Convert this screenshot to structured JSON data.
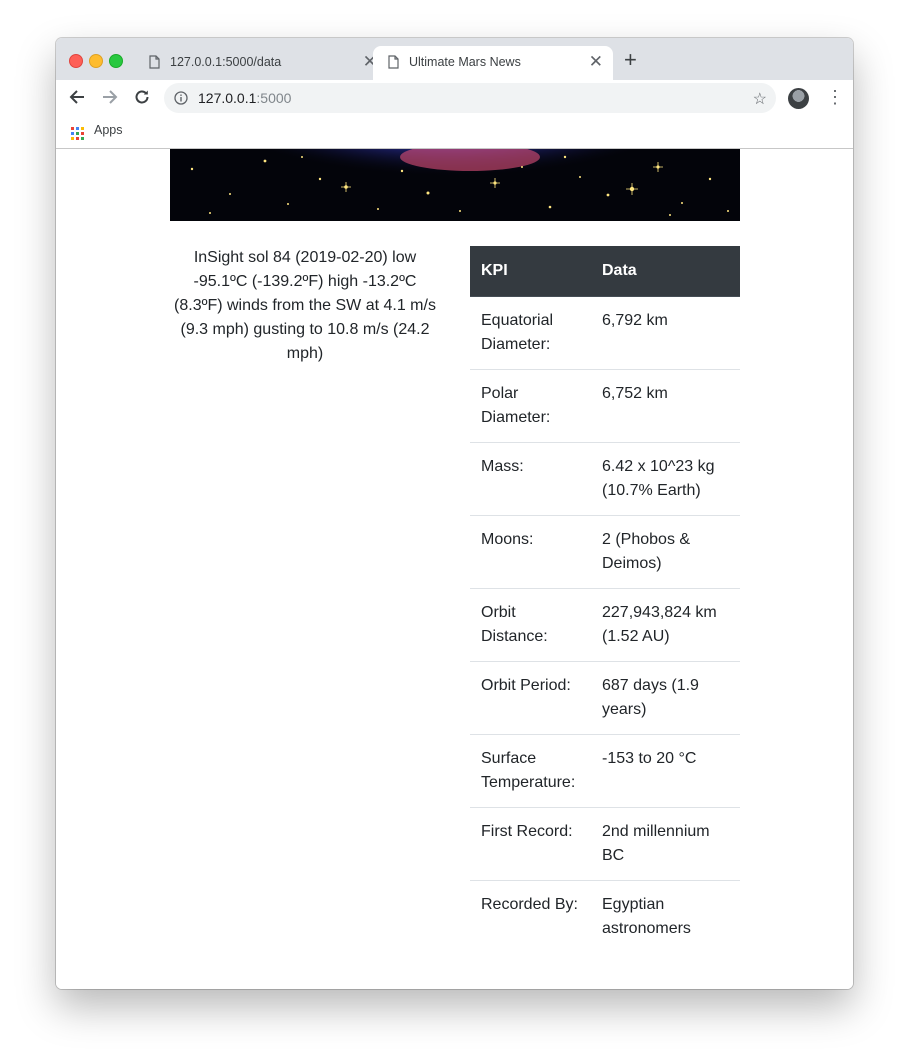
{
  "browser": {
    "tabs": [
      {
        "title": "127.0.0.1:5000/data",
        "active": false
      },
      {
        "title": "Ultimate Mars News",
        "active": true
      }
    ],
    "url_host": "127.0.0.1",
    "url_port": ":5000",
    "bookmarks": {
      "apps_label": "Apps"
    },
    "colors": {
      "tabstrip": "#dee1e6",
      "omnibox": "#f1f3f4"
    }
  },
  "page": {
    "weather_text": "InSight sol 84 (2019-02-20) low -95.1ºC (-139.2ºF) high -13.2ºC (8.3ºF) winds from the SW at 4.1 m/s (9.3 mph) gusting to 10.8 m/s (24.2 mph)",
    "facts_table": {
      "headers": {
        "kpi": "KPI",
        "data": "Data"
      },
      "rows": [
        {
          "kpi": "Equatorial Diameter:",
          "data": "6,792 km"
        },
        {
          "kpi": "Polar Diameter:",
          "data": "6,752 km"
        },
        {
          "kpi": "Mass:",
          "data": "6.42 x 10^23 kg (10.7% Earth)"
        },
        {
          "kpi": "Moons:",
          "data": "2 (Phobos & Deimos)"
        },
        {
          "kpi": "Orbit Distance:",
          "data": "227,943,824 km (1.52 AU)"
        },
        {
          "kpi": "Orbit Period:",
          "data": "687 days (1.9 years)"
        },
        {
          "kpi": "Surface Temperature:",
          "data": "-153 to 20 °C"
        },
        {
          "kpi": "First Record:",
          "data": "2nd millennium BC"
        },
        {
          "kpi": "Recorded By:",
          "data": "Egyptian astronomers"
        }
      ]
    }
  }
}
